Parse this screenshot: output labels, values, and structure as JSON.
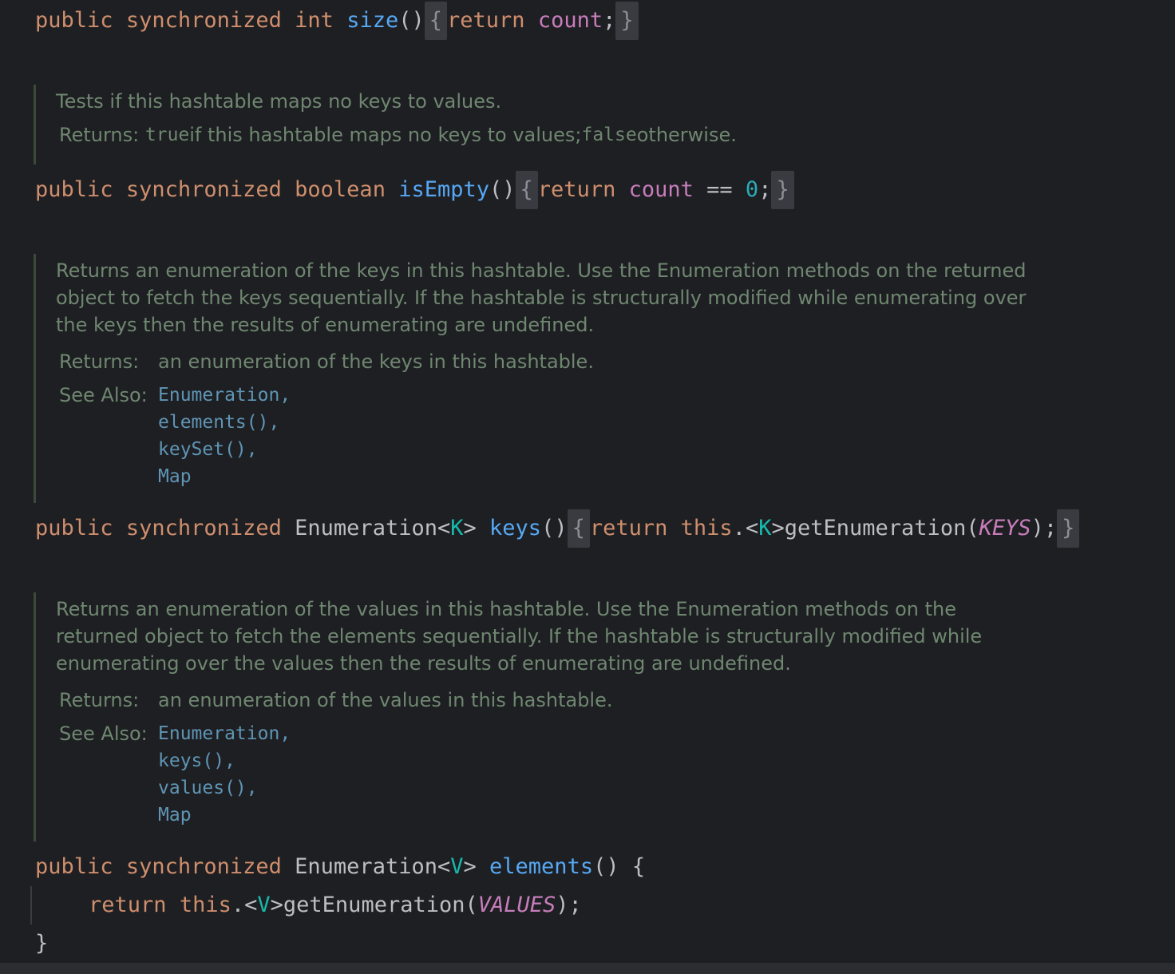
{
  "methods": [
    {
      "modifiers": [
        "public",
        "synchronized"
      ],
      "return_type": "int",
      "name": "size",
      "parens": "()",
      "body_return": "return",
      "body_field": "count",
      "semicolon": ";"
    },
    {
      "doc": {
        "description": "Tests if this hashtable maps no keys to values.",
        "returns_label": "Returns:",
        "returns_code1": "true",
        "returns_text1": " if this hashtable maps no keys to values; ",
        "returns_code2": "false",
        "returns_text2": " otherwise."
      },
      "modifiers": [
        "public",
        "synchronized"
      ],
      "return_type": "boolean",
      "name": "isEmpty",
      "parens": "()",
      "body_return": "return",
      "body_field": "count",
      "body_op": " == ",
      "body_num": "0",
      "semicolon": ";"
    },
    {
      "doc": {
        "description_lines": [
          "Returns an enumeration of the keys in this hashtable. Use the Enumeration methods on the returned",
          "object to fetch the keys sequentially. If the hashtable is structurally modified while enumerating over",
          "the keys then the results of enumerating are undefined."
        ],
        "returns_label": "Returns:",
        "returns_text": "an enumeration of the keys in this hashtable.",
        "see_also_label": "See Also:",
        "see_also": [
          "Enumeration,",
          "elements(),",
          "keySet(),",
          "Map"
        ]
      },
      "modifiers": [
        "public",
        "synchronized"
      ],
      "return_type": "Enumeration",
      "type_param": "K",
      "name": "keys",
      "parens": "()",
      "body_return": "return",
      "body_this": "this",
      "body_call": "getEnumeration",
      "body_arg": "KEYS",
      "body_tail": ");"
    },
    {
      "doc": {
        "description_lines": [
          "Returns an enumeration of the values in this hashtable. Use the Enumeration methods on the",
          "returned object to fetch the elements sequentially. If the hashtable is structurally modified while",
          "enumerating over the values then the results of enumerating are undefined."
        ],
        "returns_label": "Returns:",
        "returns_text": "an enumeration of the values in this hashtable.",
        "see_also_label": "See Also:",
        "see_also": [
          "Enumeration,",
          "keys(),",
          "values(),",
          "Map"
        ]
      },
      "modifiers": [
        "public",
        "synchronized"
      ],
      "return_type": "Enumeration",
      "type_param": "V",
      "name": "elements",
      "parens": "()",
      "body_return": "return",
      "body_this": "this",
      "body_call": "getEnumeration",
      "body_arg": "VALUES",
      "body_tail": ");"
    }
  ],
  "symbols": {
    "open_brace": "{",
    "close_brace": "}",
    "lt": "<",
    "gt": ">",
    "dot": ".",
    "open_paren": "(",
    "space": " "
  },
  "colors": {
    "background": "#1e1f22",
    "keyword": "#cf8e6d",
    "method": "#56a8f5",
    "field": "#c77dbb",
    "number": "#2aacb8",
    "type_param": "#16baac",
    "doc_text": "#6f8771",
    "doc_link": "#5f95b5"
  }
}
